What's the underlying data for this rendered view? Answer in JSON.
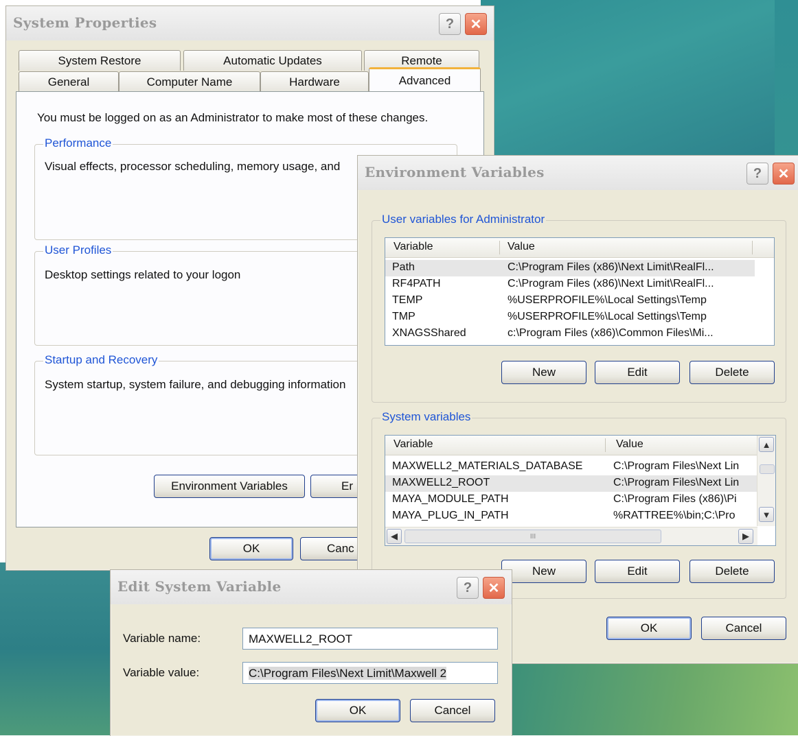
{
  "system_properties": {
    "title": "System Properties",
    "tabs_row1": [
      "System Restore",
      "Automatic Updates",
      "Remote"
    ],
    "tabs_row2": [
      "General",
      "Computer Name",
      "Hardware",
      "Advanced"
    ],
    "admin_notice": "You must be logged on as an Administrator to make most of these changes.",
    "performance": {
      "legend": "Performance",
      "text": "Visual effects, processor scheduling, memory usage, and"
    },
    "user_profiles": {
      "legend": "User Profiles",
      "text": "Desktop settings related to your logon"
    },
    "startup": {
      "legend": "Startup and Recovery",
      "text": "System startup, system failure, and debugging information"
    },
    "env_vars_button": "Environment Variables",
    "error_reporting_button": "Er",
    "ok_button": "OK",
    "cancel_button": "Canc"
  },
  "env_variables": {
    "title": "Environment Variables",
    "user_group": "User variables for Administrator",
    "user_headers": [
      "Variable",
      "Value"
    ],
    "user_rows": [
      {
        "name": "Path",
        "value": "C:\\Program Files (x86)\\Next Limit\\RealFl..."
      },
      {
        "name": "RF4PATH",
        "value": "C:\\Program Files (x86)\\Next Limit\\RealFl..."
      },
      {
        "name": "TEMP",
        "value": "%USERPROFILE%\\Local Settings\\Temp"
      },
      {
        "name": "TMP",
        "value": "%USERPROFILE%\\Local Settings\\Temp"
      },
      {
        "name": "XNAGSShared",
        "value": "c:\\Program Files (x86)\\Common Files\\Mi..."
      }
    ],
    "system_group": "System variables",
    "system_headers": [
      "Variable",
      "Value"
    ],
    "system_rows": [
      {
        "name": "MAXWELL2_MATERIALS_DATABASE",
        "value": "C:\\Program Files\\Next Lin"
      },
      {
        "name": "MAXWELL2_ROOT",
        "value": "C:\\Program Files\\Next Lin"
      },
      {
        "name": "MAYA_MODULE_PATH",
        "value": "C:\\Program Files (x86)\\Pi"
      },
      {
        "name": "MAYA_PLUG_IN_PATH",
        "value": "%RATTREE%\\bin;C:\\Pro"
      }
    ],
    "new_button": "New",
    "edit_button": "Edit",
    "delete_button": "Delete",
    "ok_button": "OK",
    "cancel_button": "Cancel",
    "scroll_thumb_grip": "III"
  },
  "edit_system_variable": {
    "title": "Edit System Variable",
    "name_label": "Variable name:",
    "name_value": "MAXWELL2_ROOT",
    "value_label": "Variable value:",
    "value_value": "C:\\Program Files\\Next Limit\\Maxwell 2",
    "ok_button": "OK",
    "cancel_button": "Cancel"
  },
  "titlebar_glyphs": {
    "help": "?",
    "close": "✕"
  },
  "colors": {
    "accent_blue": "#1f55d6",
    "tab_highlight": "#f2b23b",
    "close_red": "#e2684a"
  }
}
